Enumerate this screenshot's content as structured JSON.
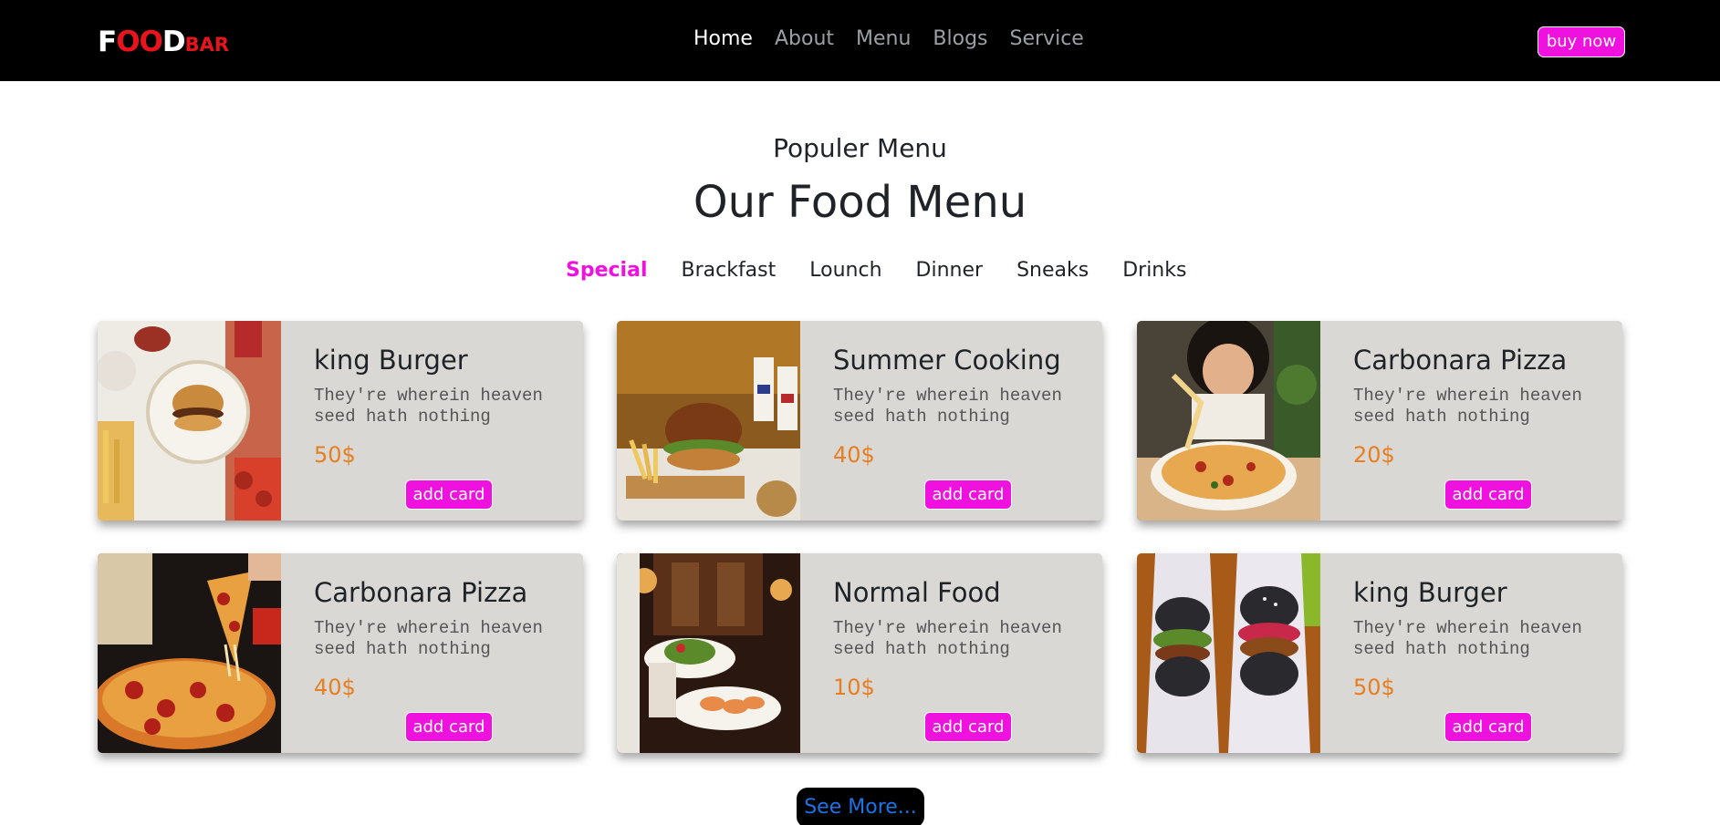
{
  "brand": {
    "logo_f": "F",
    "logo_oo": "OO",
    "logo_d": "D",
    "logo_bar": "BAR",
    "colors": {
      "white": "#ffffff",
      "red": "#e8141c"
    }
  },
  "nav": {
    "links": [
      {
        "label": "Home",
        "active": true
      },
      {
        "label": "About",
        "active": false
      },
      {
        "label": "Menu",
        "active": false
      },
      {
        "label": "Blogs",
        "active": false
      },
      {
        "label": "Service",
        "active": false
      }
    ],
    "buy_label": "buy now"
  },
  "section": {
    "subtitle": "Populer Menu",
    "title": "Our Food Menu"
  },
  "tabs": [
    {
      "label": "Special",
      "active": true
    },
    {
      "label": "Brackfast",
      "active": false
    },
    {
      "label": "Lounch",
      "active": false
    },
    {
      "label": "Dinner",
      "active": false
    },
    {
      "label": "Sneaks",
      "active": false
    },
    {
      "label": "Drinks",
      "active": false
    }
  ],
  "cards": [
    {
      "name": "king Burger",
      "desc": "They're wherein heaven seed hath nothing",
      "price": "50$",
      "button": "add card",
      "image": "burger-table-photo"
    },
    {
      "name": "Summer Cooking",
      "desc": "They're wherein heaven seed hath nothing",
      "price": "40$",
      "button": "add card",
      "image": "burger-fries-photo"
    },
    {
      "name": "Carbonara Pizza",
      "desc": "They're wherein heaven seed hath nothing",
      "price": "20$",
      "button": "add card",
      "image": "pizza-girl-photo"
    },
    {
      "name": "Carbonara Pizza",
      "desc": "They're wherein heaven seed hath nothing",
      "price": "40$",
      "button": "add card",
      "image": "pepperoni-pizza-photo"
    },
    {
      "name": "Normal Food",
      "desc": "They're wherein heaven seed hath nothing",
      "price": "10$",
      "button": "add card",
      "image": "restaurant-plates-photo"
    },
    {
      "name": "king Burger",
      "desc": "They're wherein heaven seed hath nothing",
      "price": "50$",
      "button": "add card",
      "image": "black-burgers-photo"
    }
  ],
  "see_more_label": "See More...",
  "colors": {
    "accent": "#ef12de",
    "price": "#e67e22",
    "card_bg": "#d9d8d5",
    "link": "#1a73e8"
  }
}
